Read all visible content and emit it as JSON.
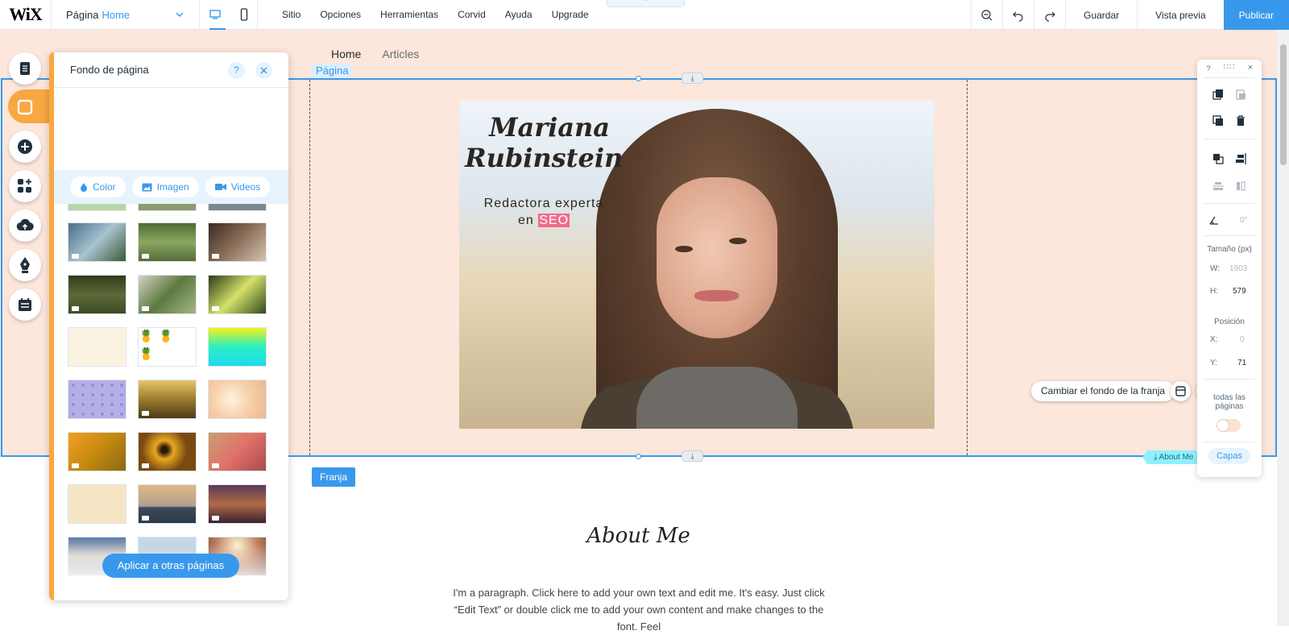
{
  "topbar": {
    "logo": "WiX",
    "page_label": "Página",
    "page_name": "Home",
    "menu": [
      "Sitio",
      "Opciones",
      "Herramientas",
      "Corvid",
      "Ayuda",
      "Upgrade"
    ],
    "save": "Guardar",
    "preview": "Vista previa",
    "publish": "Publicar"
  },
  "site": {
    "nav": [
      "Home",
      "Articles"
    ],
    "page_tag": "Página",
    "hero_title": "Mariana Rubinstein",
    "hero_sub_line1": "Redactora experta",
    "hero_sub_en": "en",
    "hero_sub_seo": "SEO",
    "about_title": "About Me",
    "about_text": "I'm a paragraph. Click here to add your own text and edit me. It's easy. Just click “Edit Text” or double click me to add your own content and make changes to the font. Feel",
    "strip_tag": "Franja",
    "anchor_label": "About Me",
    "change_bg": "Cambiar el fondo de la franja"
  },
  "panel": {
    "title": "Fondo de página",
    "help": "?",
    "tabs": [
      "Color",
      "Imagen",
      "Videos"
    ],
    "apply": "Aplicar a otras páginas"
  },
  "rpanel": {
    "help": "?",
    "angle": "0°",
    "size_label": "Tamaño (px)",
    "w_label": "W:",
    "w_val": "1903",
    "h_label": "H:",
    "h_val": "579",
    "pos_label": "Posición",
    "x_label": "X:",
    "x_val": "0",
    "y_label": "Y:",
    "y_val": "71",
    "show_all": "todas las páginas",
    "layers": "Capas"
  },
  "colors": {
    "accent": "#3899ec",
    "orange": "#f9a740",
    "strip_bg": "#fde6dc",
    "seo": "#f06c8b"
  }
}
